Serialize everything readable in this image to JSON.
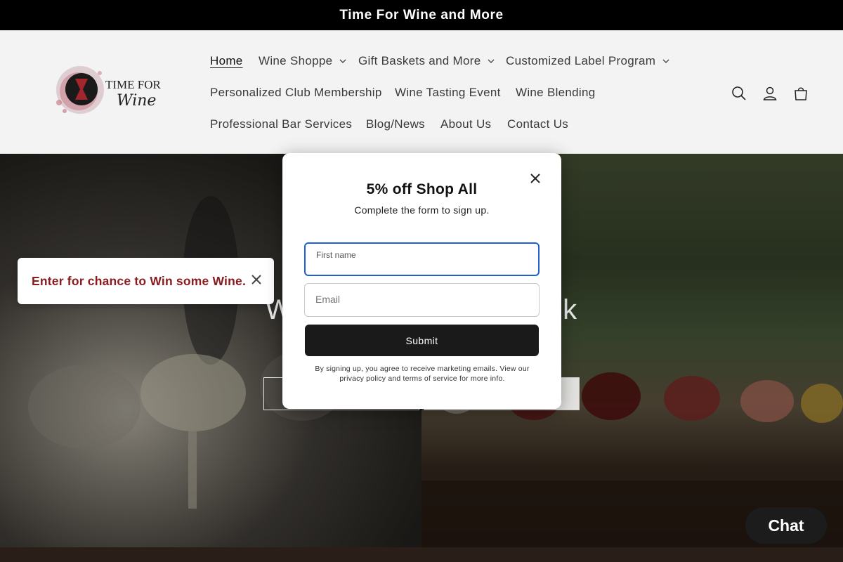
{
  "announcement": {
    "text": "Time For Wine and More"
  },
  "header": {
    "logo_text_line1": "TIME FOR",
    "logo_text_line2": "Wine",
    "nav": [
      {
        "label": "Home",
        "active": true,
        "has_dropdown": false
      },
      {
        "label": "Wine Shoppe",
        "has_dropdown": true
      },
      {
        "label": "Gift Baskets and More",
        "has_dropdown": true
      },
      {
        "label": "Customized Label Program",
        "has_dropdown": true
      },
      {
        "label": "Personalized Club Membership",
        "has_dropdown": false
      },
      {
        "label": "Wine Tasting Event",
        "has_dropdown": false
      },
      {
        "label": "Wine Blending",
        "has_dropdown": false
      },
      {
        "label": "Professional Bar Services",
        "has_dropdown": false
      },
      {
        "label": "Blog/News",
        "has_dropdown": false
      },
      {
        "label": "About Us",
        "has_dropdown": false
      },
      {
        "label": "Contact Us",
        "has_dropdown": false
      }
    ],
    "icons": [
      "search-icon",
      "account-icon",
      "cart-icon"
    ]
  },
  "hero": {
    "title_left": "Wh",
    "title_right": "hink"
  },
  "side_popup": {
    "text": "Enter for chance to Win some Wine."
  },
  "modal": {
    "title": "5% off Shop All",
    "subtitle": "Complete the form to sign up.",
    "first_name_label": "First name",
    "email_placeholder": "Email",
    "submit_label": "Submit",
    "legal": "By signing up, you agree to receive marketing emails. View our privacy policy and terms of service for more info."
  },
  "chat": {
    "label": "Chat"
  },
  "colors": {
    "accent_red": "#8a1c20",
    "dark": "#1a1a1a",
    "focus_blue": "#1f5fd1"
  }
}
